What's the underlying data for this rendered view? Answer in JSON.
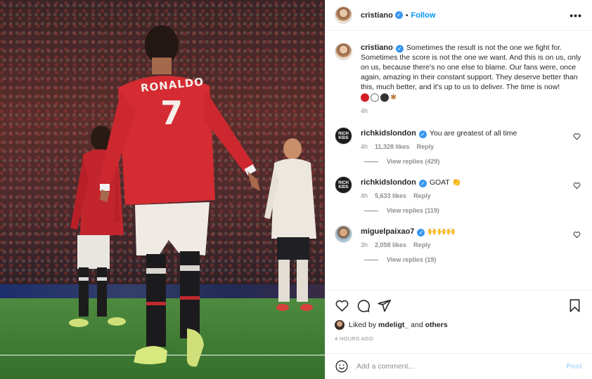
{
  "post": {
    "author": "cristiano",
    "follow_label": "Follow",
    "more_label": "•••",
    "caption": "Sometimes the result is not the one we fight for. Sometimes the score is not the one we want. And this is on us, only on us, because there's no one else to blame. Our fans were, once again, amazing in their constant support. They deserve better than this, much better, and it's up to us to deliver. The time is now!",
    "caption_emojis": [
      "red-circle",
      "white-circle",
      "black-circle",
      "flexed-biceps"
    ],
    "caption_age": "4h",
    "colors": {
      "accent": "#0095f6",
      "verified": "#3897f0",
      "muted": "#8e8e8e",
      "text": "#262626",
      "post_disabled": "#b3dbff"
    }
  },
  "photo": {
    "shirt_name": "RONALDO",
    "shirt_number": "7"
  },
  "comments": [
    {
      "username": "richkidslondon",
      "avatar_text": "RICH KIDS",
      "text": "You are greatest of all time",
      "age": "4h",
      "likes": "11,328 likes",
      "reply_label": "Reply",
      "view_replies": "View replies (429)"
    },
    {
      "username": "richkidslondon",
      "avatar_text": "RICH KIDS",
      "text": "GOAT 👏",
      "age": "4h",
      "likes": "5,633 likes",
      "reply_label": "Reply",
      "view_replies": "View replies (119)"
    },
    {
      "username": "miguelpaixao7",
      "text": "🙌🙌🙌",
      "age": "3h",
      "likes": "2,058 likes",
      "reply_label": "Reply",
      "view_replies": "View replies (19)"
    }
  ],
  "engagement": {
    "liked_by_prefix": "Liked by",
    "liked_by_user": "mdeligt_",
    "liked_by_and": "and",
    "liked_by_others": "others",
    "timestamp": "4 HOURS AGO"
  },
  "add_comment": {
    "placeholder": "Add a comment...",
    "post_label": "Post"
  }
}
